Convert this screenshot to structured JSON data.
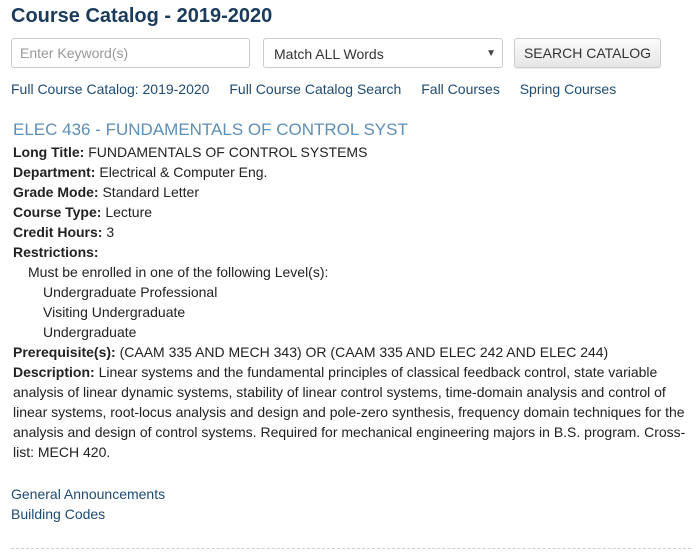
{
  "header": {
    "title": "Course Catalog - 2019-2020"
  },
  "search": {
    "placeholder": "Enter Keyword(s)",
    "value": "",
    "match_mode": "Match ALL Words",
    "button_label": "SEARCH CATALOG"
  },
  "nav": {
    "links": [
      "Full Course Catalog: 2019-2020",
      "Full Course Catalog Search",
      "Fall Courses",
      "Spring Courses"
    ]
  },
  "course": {
    "heading": "ELEC 436 - FUNDAMENTALS OF CONTROL SYST",
    "long_title_label": "Long Title:",
    "long_title": "FUNDAMENTALS OF CONTROL SYSTEMS",
    "department_label": "Department:",
    "department": "Electrical & Computer Eng.",
    "grade_mode_label": "Grade Mode:",
    "grade_mode": "Standard Letter",
    "course_type_label": "Course Type:",
    "course_type": "Lecture",
    "credit_hours_label": "Credit Hours:",
    "credit_hours": "3",
    "restrictions_label": "Restrictions:",
    "restrictions_intro": "Must be enrolled in one of the following Level(s):",
    "levels": [
      "Undergraduate Professional",
      "Visiting Undergraduate",
      "Undergraduate"
    ],
    "prerequisites_label": "Prerequisite(s):",
    "prerequisites": "(CAAM 335 AND MECH 343) OR (CAAM 335 AND ELEC 242 AND ELEC 244)",
    "description_label": "Description:",
    "description": "Linear systems and the fundamental principles of classical feedback control, state variable analysis of linear dynamic systems, stability of linear control systems, time-domain analysis and control of linear systems, root-locus analysis and design and pole-zero synthesis, frequency domain techniques for the analysis and design of control systems. Required for mechanical engineering majors in B.S. program. Cross-list: MECH 420."
  },
  "footer": {
    "links": [
      "General Announcements",
      "Building Codes"
    ]
  },
  "colors": {
    "title": "#1b3b5c",
    "link": "#1e4b73",
    "course_heading": "#5d8fb8"
  },
  "icons": {
    "select_caret": "caret-down-icon"
  }
}
